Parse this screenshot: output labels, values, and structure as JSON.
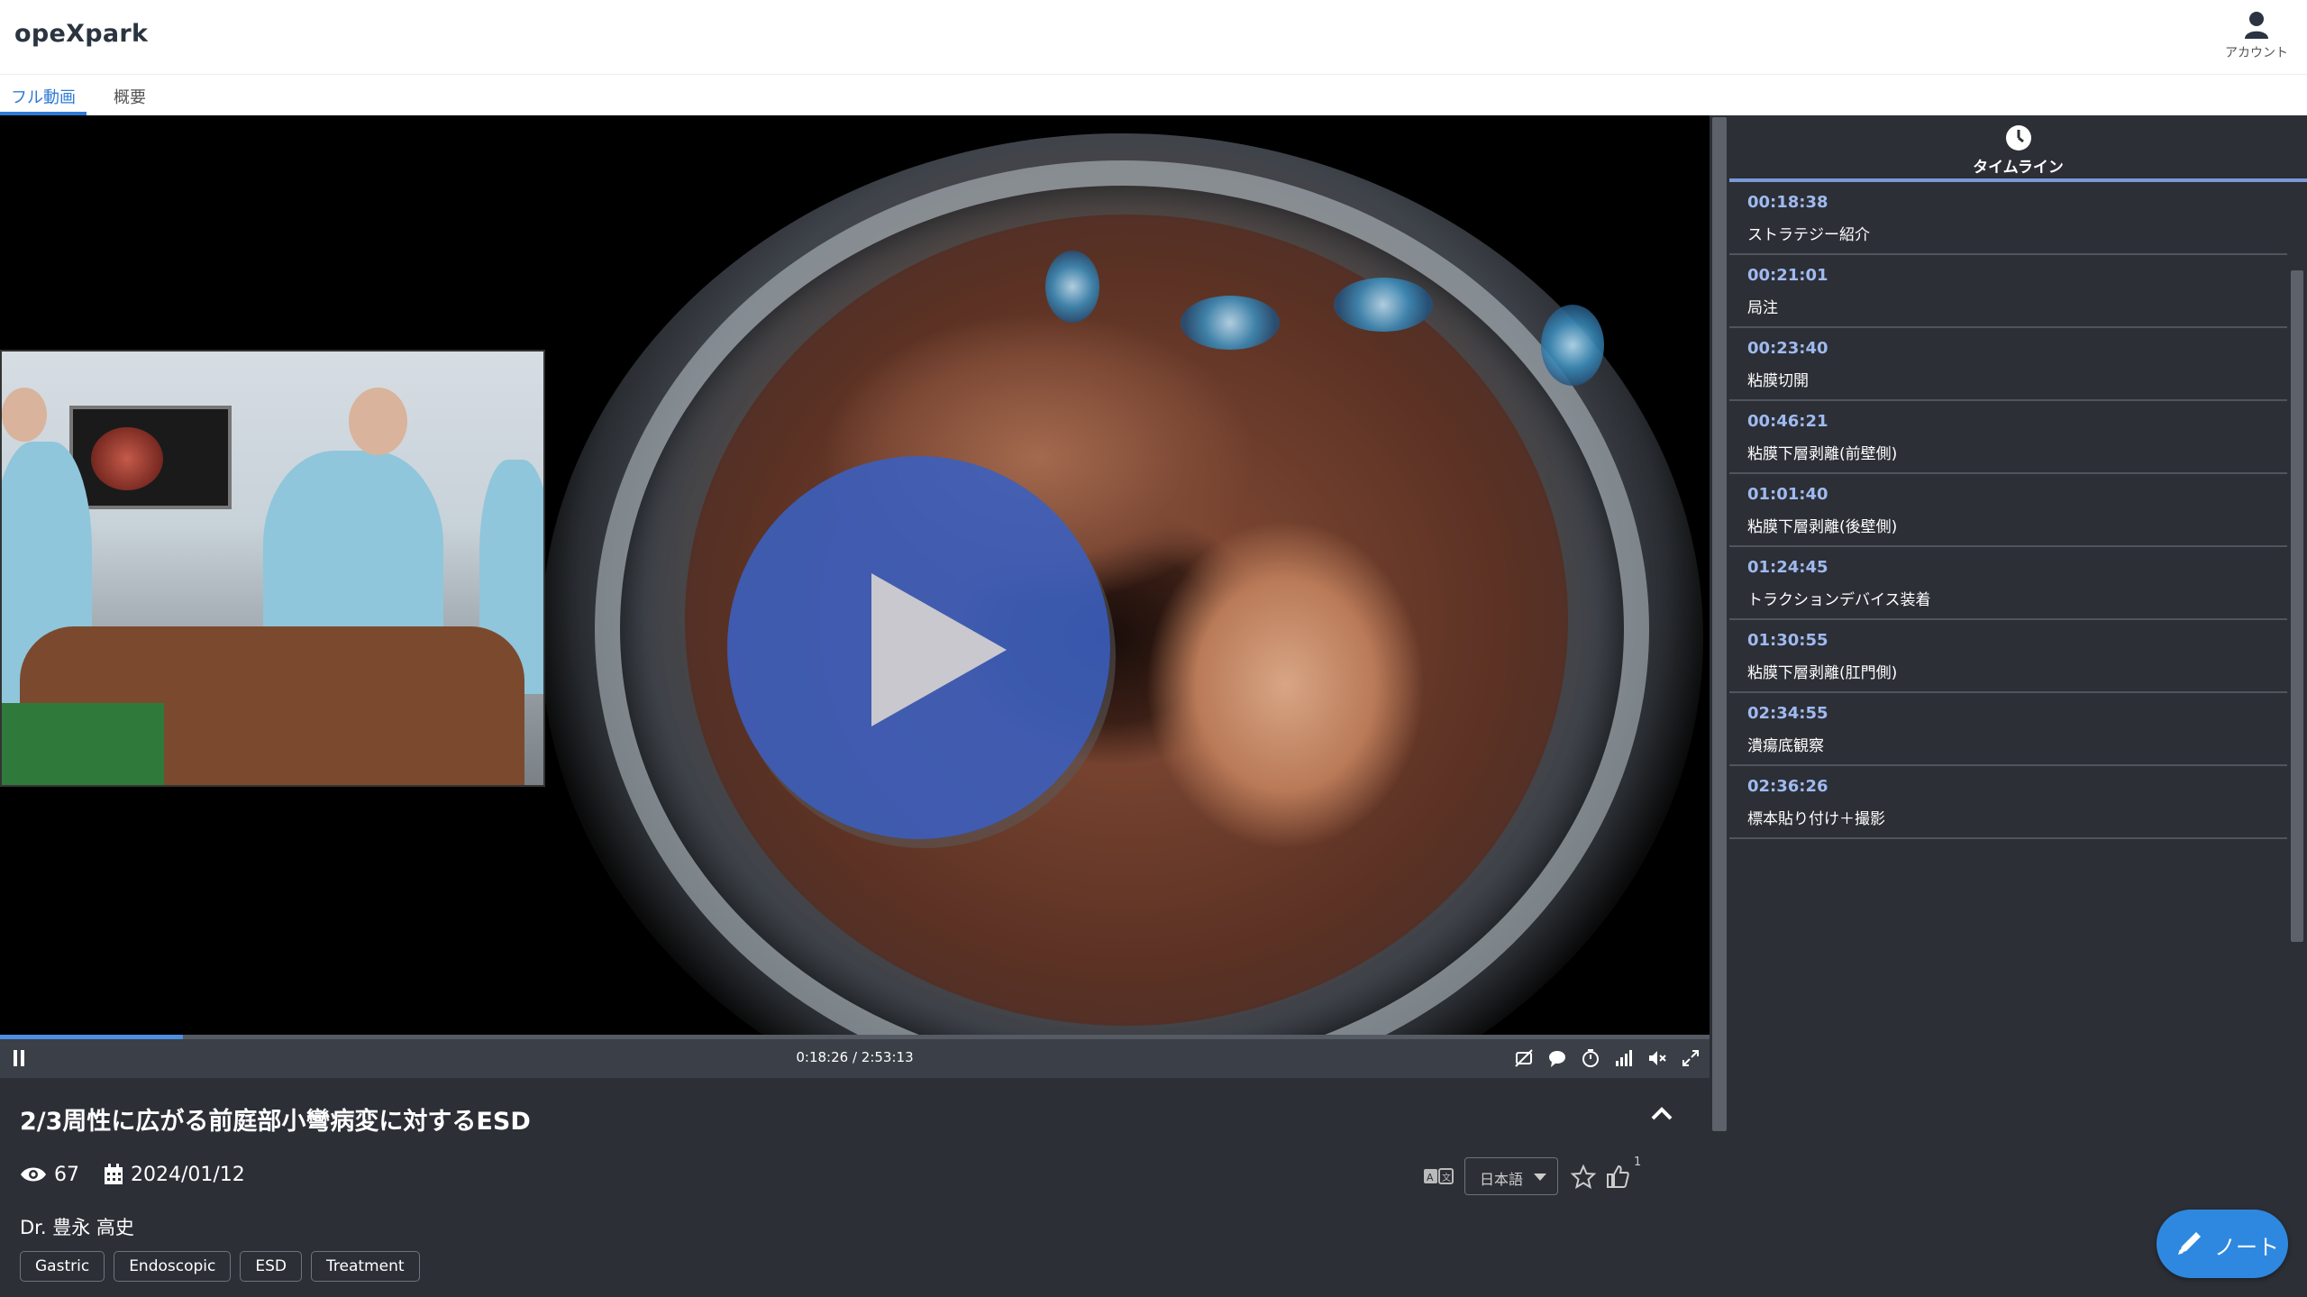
{
  "app": {
    "name": "opeXpark"
  },
  "header": {
    "account_label": "アカウント"
  },
  "tabs": [
    {
      "label": "フル動画",
      "active": true
    },
    {
      "label": "概要",
      "active": false
    }
  ],
  "player": {
    "timecode": "0:18:26 / 2:53:13",
    "progress_fraction": 0.107,
    "state": "paused",
    "accent_color": "#4d8fe0"
  },
  "video": {
    "title": "2/3周性に広がる前庭部小彎病変に対するESD",
    "views": "67",
    "date": "2024/01/12",
    "author": "Dr. 豊永 高史",
    "tags": [
      "Gastric",
      "Endoscopic",
      "ESD",
      "Treatment"
    ],
    "language": "日本語",
    "like_count": "1"
  },
  "timeline": {
    "header": "タイムライン",
    "items": [
      {
        "time": "00:18:38",
        "label": "ストラテジー紹介"
      },
      {
        "time": "00:21:01",
        "label": "局注"
      },
      {
        "time": "00:23:40",
        "label": "粘膜切開"
      },
      {
        "time": "00:46:21",
        "label": "粘膜下層剥離(前壁側)"
      },
      {
        "time": "01:01:40",
        "label": "粘膜下層剥離(後壁側)"
      },
      {
        "time": "01:24:45",
        "label": "トラクションデバイス装着"
      },
      {
        "time": "01:30:55",
        "label": "粘膜下層剥離(肛門側)"
      },
      {
        "time": "02:34:55",
        "label": "潰瘍底観察"
      },
      {
        "time": "02:36:26",
        "label": "標本貼り付け＋撮影"
      }
    ]
  },
  "note_button": {
    "label": "ノート"
  }
}
